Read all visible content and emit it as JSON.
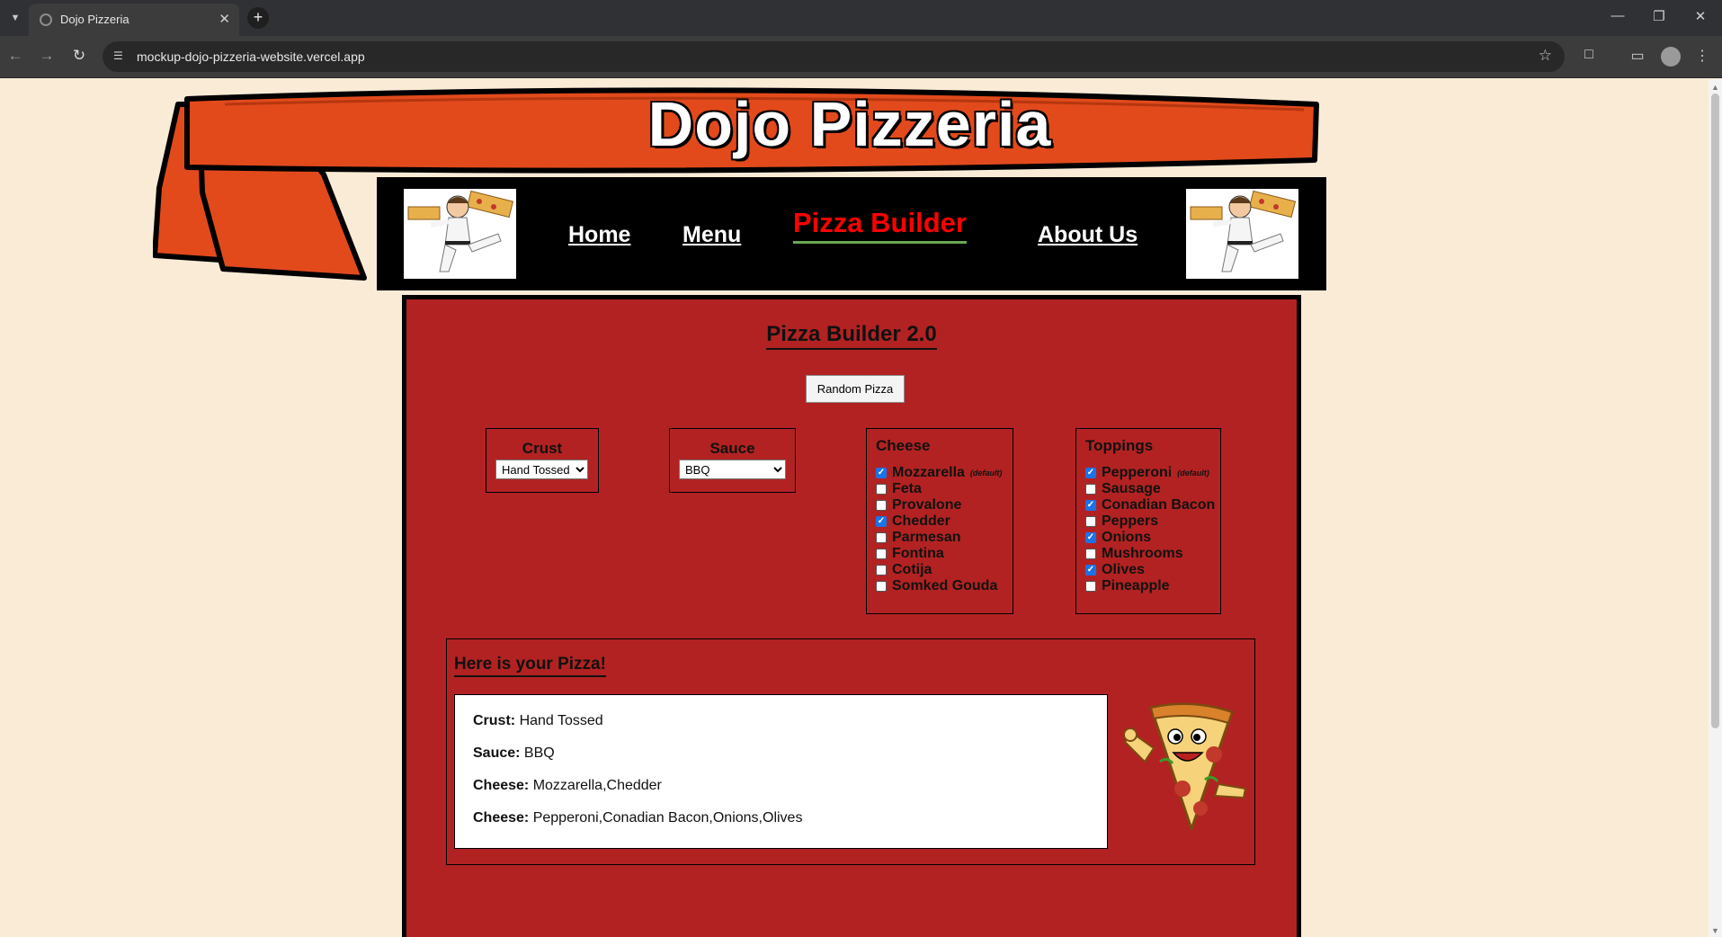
{
  "browser": {
    "tab_title": "Dojo Pizzeria",
    "url": "mockup-dojo-pizzeria-website.vercel.app"
  },
  "site": {
    "title": "Dojo Pizzeria"
  },
  "nav": {
    "items": [
      {
        "label": "Home",
        "active": false
      },
      {
        "label": "Menu",
        "active": false
      },
      {
        "label": "Pizza Builder",
        "active": true
      },
      {
        "label": "About Us",
        "active": false
      }
    ]
  },
  "builder": {
    "title": "Pizza Builder 2.0",
    "random_button": "Random Pizza",
    "crust": {
      "label": "Crust",
      "selected": "Hand Tossed"
    },
    "sauce": {
      "label": "Sauce",
      "selected": "BBQ"
    },
    "cheese": {
      "label": "Cheese",
      "default_note": "(default)",
      "items": [
        {
          "label": "Mozzarella",
          "checked": true,
          "default": true
        },
        {
          "label": "Feta",
          "checked": false
        },
        {
          "label": "Provalone",
          "checked": false
        },
        {
          "label": "Chedder",
          "checked": true
        },
        {
          "label": "Parmesan",
          "checked": false
        },
        {
          "label": "Fontina",
          "checked": false
        },
        {
          "label": "Cotija",
          "checked": false
        },
        {
          "label": "Somked Gouda",
          "checked": false
        }
      ]
    },
    "toppings": {
      "label": "Toppings",
      "default_note": "(default)",
      "items": [
        {
          "label": "Pepperoni",
          "checked": true,
          "default": true
        },
        {
          "label": "Sausage",
          "checked": false
        },
        {
          "label": "Conadian Bacon",
          "checked": true
        },
        {
          "label": "Peppers",
          "checked": false
        },
        {
          "label": "Onions",
          "checked": true
        },
        {
          "label": "Mushrooms",
          "checked": false
        },
        {
          "label": "Olives",
          "checked": true
        },
        {
          "label": "Pineapple",
          "checked": false
        }
      ]
    }
  },
  "result": {
    "title": "Here is your Pizza!",
    "lines": [
      {
        "key": "Crust:",
        "value": "Hand Tossed"
      },
      {
        "key": "Sauce:",
        "value": "BBQ"
      },
      {
        "key": "Cheese:",
        "value": "Mozzarella,Chedder"
      },
      {
        "key": "Cheese:",
        "value": "Pepperoni,Conadian Bacon,Onions,Olives"
      }
    ]
  },
  "colors": {
    "page_bg": "#faebd7",
    "panel_bg": "#b22222",
    "belt_orange": "#e24a1c",
    "active_nav": "#ff0000",
    "active_underline": "#6aa84f"
  }
}
